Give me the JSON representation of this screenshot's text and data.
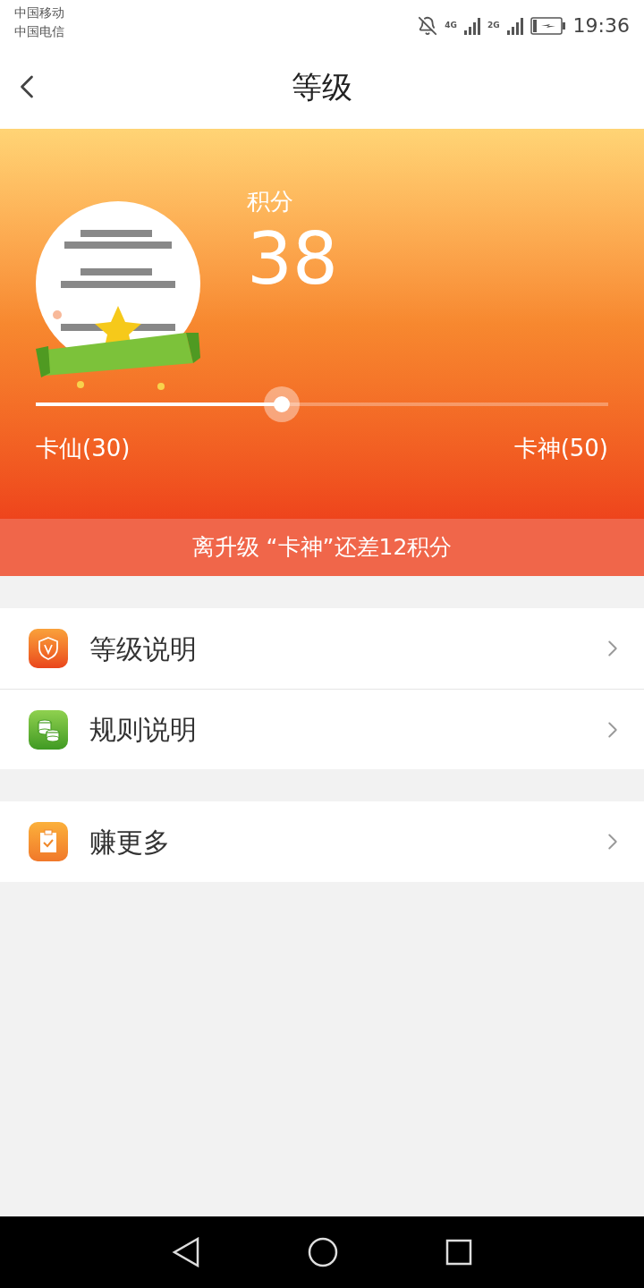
{
  "status_bar": {
    "carriers": [
      "中国移动",
      "中国电信"
    ],
    "network_1": "4G",
    "network_2": "2G",
    "time": "19:36"
  },
  "header": {
    "title": "等级"
  },
  "level_card": {
    "points_label": "积分",
    "points": "38",
    "progress": {
      "level": 0.43
    },
    "current_level": "卡仙(30)",
    "next_level": "卡神(50)"
  },
  "notice": "离升级 “卡神”还差12积分",
  "menu_groups": [
    [
      {
        "kind": "shield",
        "label": "等级说明"
      },
      {
        "kind": "coins",
        "label": "规则说明"
      }
    ],
    [
      {
        "kind": "clipboard",
        "label": "赚更多"
      }
    ]
  ]
}
